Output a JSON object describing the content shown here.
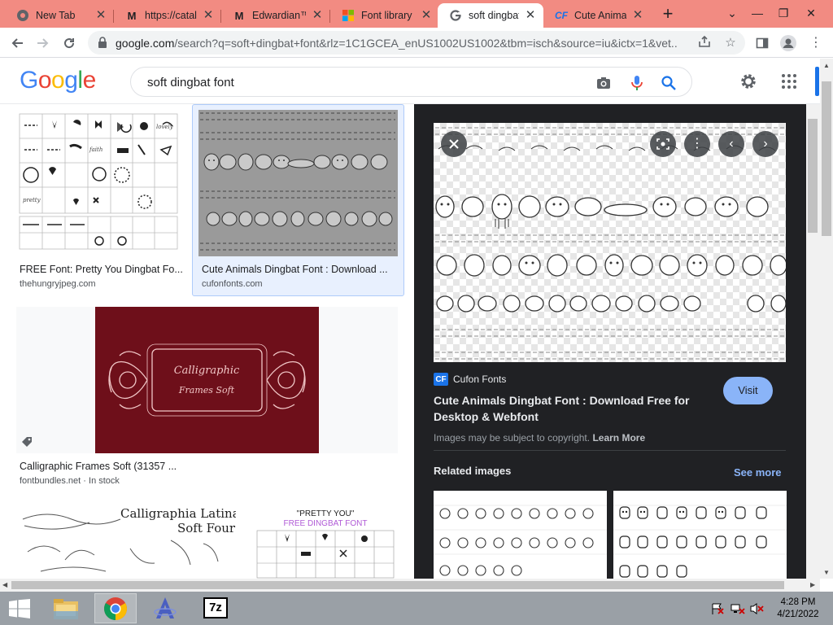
{
  "tabs": [
    {
      "title": "New Tab",
      "icon": "chrome-icon"
    },
    {
      "title": "https://catal",
      "icon": "gmail-icon"
    },
    {
      "title": "Edwardian™",
      "icon": "gmail-icon"
    },
    {
      "title": "Font library",
      "icon": "microsoft-icon"
    },
    {
      "title": "soft dingbat",
      "icon": "google-icon",
      "active": true
    },
    {
      "title": "Cute Animal",
      "icon": "cufon-icon"
    }
  ],
  "address_bar": {
    "host": "google.com",
    "path": "/search?q=soft+dingbat+font&rlz=1C1GCEA_enUS1002US1002&tbm=isch&source=iu&ictx=1&vet..."
  },
  "logo_letters": [
    {
      "ch": "G",
      "color": "#4285F4"
    },
    {
      "ch": "o",
      "color": "#EA4335"
    },
    {
      "ch": "o",
      "color": "#FBBC05"
    },
    {
      "ch": "g",
      "color": "#4285F4"
    },
    {
      "ch": "l",
      "color": "#34A853"
    },
    {
      "ch": "e",
      "color": "#EA4335"
    }
  ],
  "search": {
    "query": "soft dingbat font"
  },
  "results": [
    {
      "title": "FREE Font: Pretty You Dingbat Fo...",
      "source": "thehungryjpeg.com"
    },
    {
      "title": "Cute Animals Dingbat Font : Download ...",
      "source": "cufonfonts.com"
    },
    {
      "title": "Calligraphic Frames Soft (31357 ...",
      "source": "fontbundles.net",
      "stock": "In stock"
    }
  ],
  "partial_cards": {
    "left_text_line1": "Calligraphia Latina",
    "left_text_line2": "Soft Four",
    "right_text_line1": "\"PRETTY YOU\"",
    "right_text_line2": "FREE DINGBAT FONT"
  },
  "calligraphic_thumb": {
    "line1": "Calligraphic",
    "line2": "Frames Soft"
  },
  "preview": {
    "source_logo": "CF",
    "source_name": "Cufon Fonts",
    "title": "Cute Animals Dingbat Font : Download Free for Desktop & Webfont",
    "visit_label": "Visit",
    "copyright_text": "Images may be subject to copyright.",
    "learn_more": "Learn More",
    "related_label": "Related images",
    "see_more_label": "See more"
  },
  "taskbar": {
    "time": "4:28 PM",
    "date": "4/21/2022",
    "sevenzip_label": "7z"
  },
  "colors": {
    "tab_strip": "#f28b82",
    "preview_bg": "#202124",
    "visit_btn": "#8ab4f8",
    "maroon_thumb": "#6e0f1a",
    "taskbar": "#9aa0a6"
  }
}
